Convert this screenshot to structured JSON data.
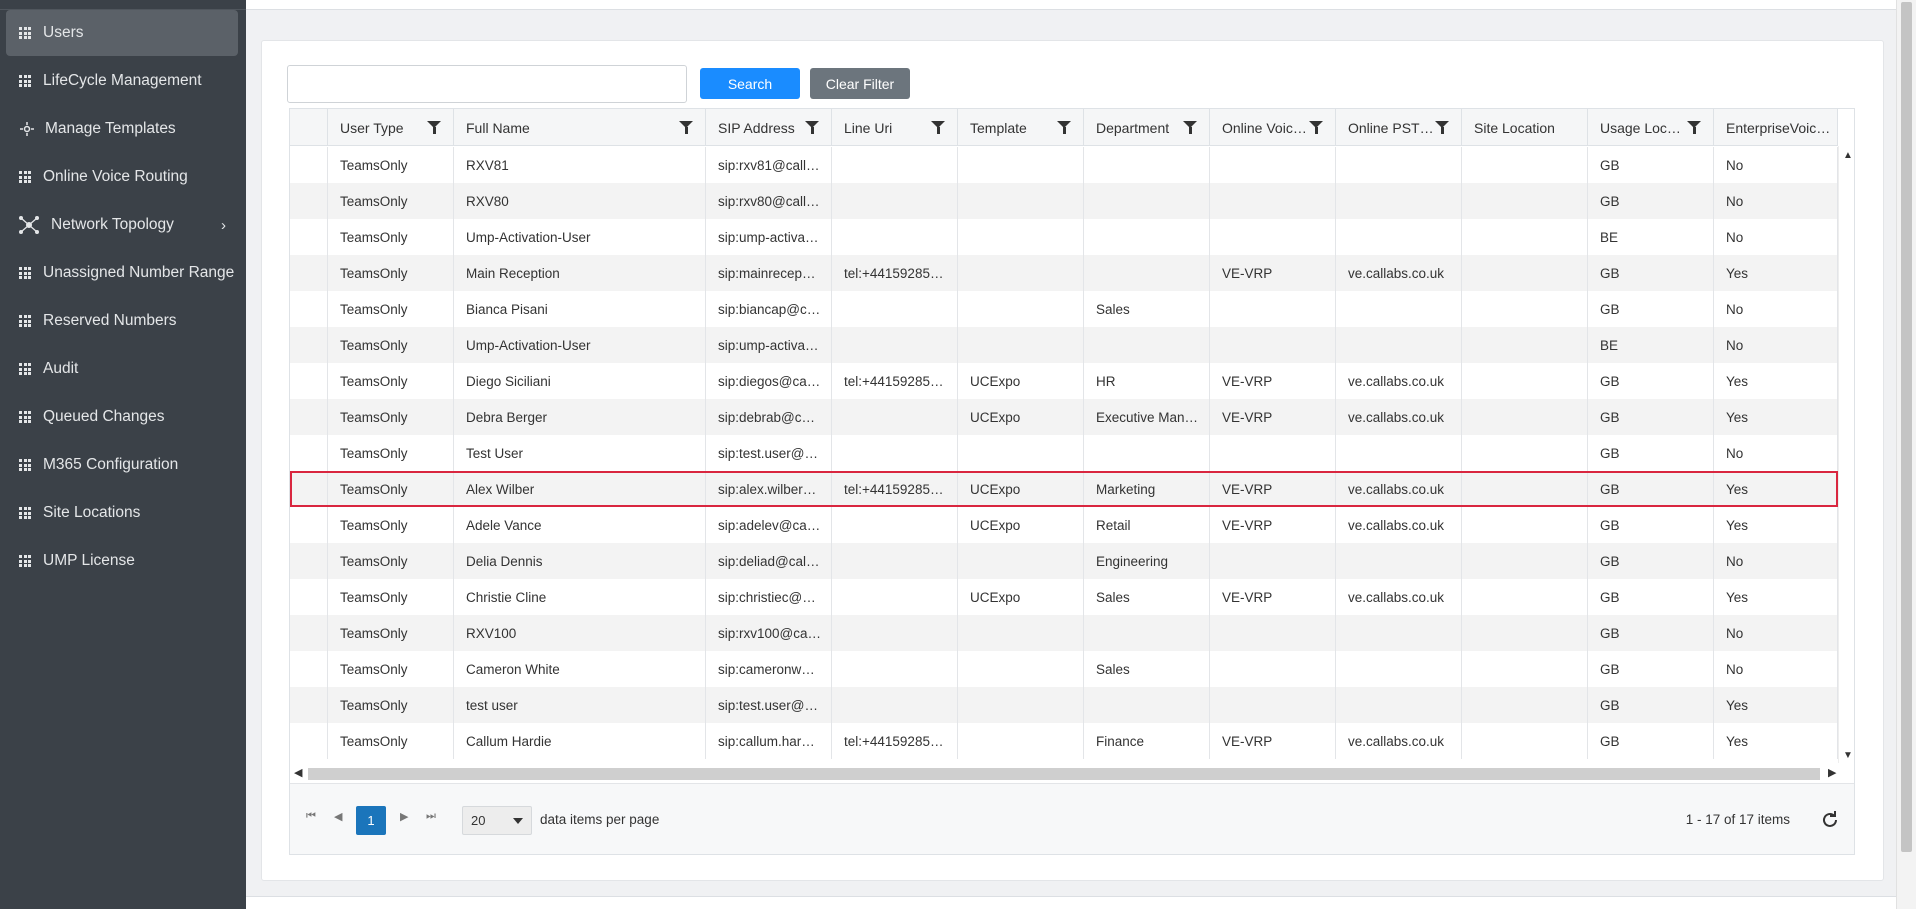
{
  "sidebar": {
    "items": [
      {
        "label": "Users",
        "icon": "grid-icon",
        "active": true
      },
      {
        "label": "LifeCycle Management",
        "icon": "grid-icon"
      },
      {
        "label": "Manage Templates",
        "icon": "template-icon"
      },
      {
        "label": "Online Voice Routing",
        "icon": "grid-icon"
      },
      {
        "label": "Network Topology",
        "icon": "network-icon",
        "expandable": true
      },
      {
        "label": "Unassigned Number Range",
        "icon": "grid-icon"
      },
      {
        "label": "Reserved Numbers",
        "icon": "grid-icon"
      },
      {
        "label": "Audit",
        "icon": "grid-icon"
      },
      {
        "label": "Queued Changes",
        "icon": "grid-icon"
      },
      {
        "label": "M365 Configuration",
        "icon": "grid-icon"
      },
      {
        "label": "Site Locations",
        "icon": "grid-icon"
      },
      {
        "label": "UMP License",
        "icon": "grid-icon"
      }
    ]
  },
  "search": {
    "value": "",
    "placeholder": "",
    "search_label": "Search",
    "clear_label": "Clear Filter"
  },
  "grid": {
    "columns": [
      {
        "label": "",
        "filter": false
      },
      {
        "label": "User Type",
        "filter": true
      },
      {
        "label": "Full Name",
        "filter": true
      },
      {
        "label": "SIP Address",
        "filter": true
      },
      {
        "label": "Line Uri",
        "filter": true
      },
      {
        "label": "Template",
        "filter": true
      },
      {
        "label": "Department",
        "filter": true
      },
      {
        "label": "Online Voic…",
        "filter": true
      },
      {
        "label": "Online PST…",
        "filter": true
      },
      {
        "label": "Site Location",
        "filter": false
      },
      {
        "label": "Usage Loc…",
        "filter": true
      },
      {
        "label": "EnterpriseVoic…",
        "filter": false
      }
    ],
    "rows": [
      [
        "",
        "TeamsOnly",
        "RXV81",
        "sip:rxv81@call…",
        "",
        "",
        "",
        "",
        "",
        "",
        "GB",
        "No"
      ],
      [
        "",
        "TeamsOnly",
        "RXV80",
        "sip:rxv80@call…",
        "",
        "",
        "",
        "",
        "",
        "",
        "GB",
        "No"
      ],
      [
        "",
        "TeamsOnly",
        "Ump-Activation-User",
        "sip:ump-activa…",
        "",
        "",
        "",
        "",
        "",
        "",
        "BE",
        "No"
      ],
      [
        "",
        "TeamsOnly",
        "Main Reception",
        "sip:mainrecep…",
        "tel:+44159285…",
        "",
        "",
        "VE-VRP",
        "ve.callabs.co.uk",
        "",
        "GB",
        "Yes"
      ],
      [
        "",
        "TeamsOnly",
        "Bianca Pisani",
        "sip:biancap@c…",
        "",
        "",
        "Sales",
        "",
        "",
        "",
        "GB",
        "No"
      ],
      [
        "",
        "TeamsOnly",
        "Ump-Activation-User",
        "sip:ump-activa…",
        "",
        "",
        "",
        "",
        "",
        "",
        "BE",
        "No"
      ],
      [
        "",
        "TeamsOnly",
        "Diego Siciliani",
        "sip:diegos@ca…",
        "tel:+44159285…",
        "UCExpo",
        "HR",
        "VE-VRP",
        "ve.callabs.co.uk",
        "",
        "GB",
        "Yes"
      ],
      [
        "",
        "TeamsOnly",
        "Debra Berger",
        "sip:debrab@c…",
        "",
        "UCExpo",
        "Executive Man…",
        "VE-VRP",
        "ve.callabs.co.uk",
        "",
        "GB",
        "Yes"
      ],
      [
        "",
        "TeamsOnly",
        "Test User",
        "sip:test.user@…",
        "",
        "",
        "",
        "",
        "",
        "",
        "GB",
        "No"
      ],
      [
        "",
        "TeamsOnly",
        "Alex Wilber",
        "sip:alex.wilber…",
        "tel:+44159285…",
        "UCExpo",
        "Marketing",
        "VE-VRP",
        "ve.callabs.co.uk",
        "",
        "GB",
        "Yes"
      ],
      [
        "",
        "TeamsOnly",
        "Adele Vance",
        "sip:adelev@ca…",
        "",
        "UCExpo",
        "Retail",
        "VE-VRP",
        "ve.callabs.co.uk",
        "",
        "GB",
        "Yes"
      ],
      [
        "",
        "TeamsOnly",
        "Delia Dennis",
        "sip:deliad@cal…",
        "",
        "",
        "Engineering",
        "",
        "",
        "",
        "GB",
        "No"
      ],
      [
        "",
        "TeamsOnly",
        "Christie Cline",
        "sip:christiec@…",
        "",
        "UCExpo",
        "Sales",
        "VE-VRP",
        "ve.callabs.co.uk",
        "",
        "GB",
        "Yes"
      ],
      [
        "",
        "TeamsOnly",
        "RXV100",
        "sip:rxv100@ca…",
        "",
        "",
        "",
        "",
        "",
        "",
        "GB",
        "No"
      ],
      [
        "",
        "TeamsOnly",
        "Cameron White",
        "sip:cameronw…",
        "",
        "",
        "Sales",
        "",
        "",
        "",
        "GB",
        "No"
      ],
      [
        "",
        "TeamsOnly",
        "test user",
        "sip:test.user@…",
        "",
        "",
        "",
        "",
        "",
        "",
        "GB",
        "Yes"
      ],
      [
        "",
        "TeamsOnly",
        "Callum Hardie",
        "sip:callum.har…",
        "tel:+44159285…",
        "",
        "Finance",
        "VE-VRP",
        "ve.callabs.co.uk",
        "",
        "GB",
        "Yes"
      ]
    ],
    "selected_row_index": 9
  },
  "pager": {
    "current_page": "1",
    "page_size": "20",
    "per_page_label": "data items per page",
    "info": "1 - 17 of 17 items"
  },
  "colors": {
    "sidebar_bg": "#3b4148",
    "sidebar_active": "#5b6168",
    "search_button": "#1a8cff",
    "clear_button": "#6c757d",
    "page_active": "#1b75bb",
    "selection_outline": "#d9263f"
  }
}
